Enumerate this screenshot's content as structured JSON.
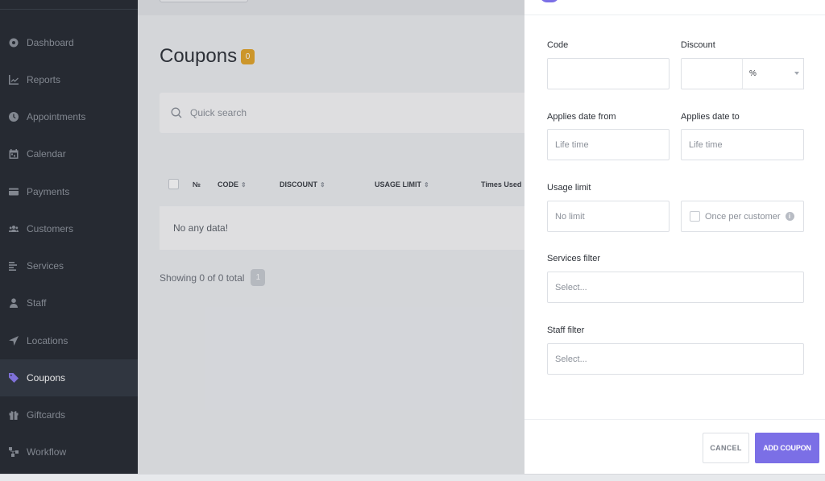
{
  "sidebar": {
    "items": [
      {
        "label": "Dashboard",
        "icon": "dashboard-icon"
      },
      {
        "label": "Reports",
        "icon": "chart-line-icon"
      },
      {
        "label": "Appointments",
        "icon": "clock-icon"
      },
      {
        "label": "Calendar",
        "icon": "calendar-icon"
      },
      {
        "label": "Payments",
        "icon": "credit-card-icon"
      },
      {
        "label": "Customers",
        "icon": "users-icon"
      },
      {
        "label": "Services",
        "icon": "list-icon"
      },
      {
        "label": "Staff",
        "icon": "user-icon"
      },
      {
        "label": "Locations",
        "icon": "location-arrow-icon"
      },
      {
        "label": "Coupons",
        "icon": "tag-icon"
      },
      {
        "label": "Giftcards",
        "icon": "gift-icon"
      },
      {
        "label": "Workflow",
        "icon": "workflow-icon"
      }
    ],
    "active": "Coupons"
  },
  "main": {
    "title": "Coupons",
    "count": "0",
    "search_placeholder": "Quick search",
    "columns": {
      "number": "№",
      "code": "CODE",
      "discount": "DISCOUNT",
      "usage_limit": "USAGE LIMIT",
      "times_used": "Times Used"
    },
    "sort_glyph": "⇕",
    "empty_text": "No any data!",
    "showing": "Showing 0 of 0 total",
    "page": "1"
  },
  "panel": {
    "code_label": "Code",
    "discount_label": "Discount",
    "discount_unit": "%",
    "applies_from_label": "Applies date from",
    "applies_from_placeholder": "Life time",
    "applies_to_label": "Applies date to",
    "applies_to_placeholder": "Life time",
    "usage_limit_label": "Usage limit",
    "usage_limit_placeholder": "No limit",
    "once_per_customer": "Once per customer",
    "info_glyph": "i",
    "services_filter_label": "Services filter",
    "services_filter_placeholder": "Select...",
    "staff_filter_label": "Staff filter",
    "staff_filter_placeholder": "Select...",
    "cancel": "CANCEL",
    "add": "ADD COUPON"
  },
  "colors": {
    "sidebar_bg": "#262b33",
    "accent": "#7b6fe6",
    "badge": "#e3a52b"
  }
}
